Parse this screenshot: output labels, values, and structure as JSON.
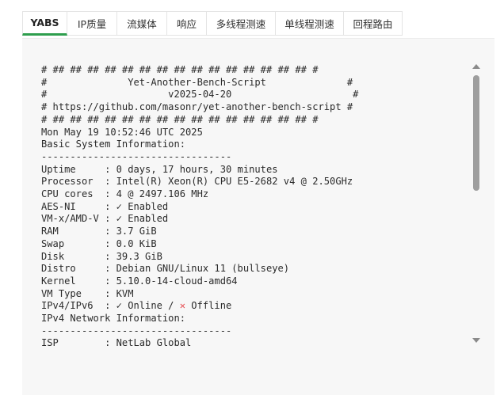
{
  "tabs": [
    {
      "label": "YABS",
      "active": true
    },
    {
      "label": "IP质量",
      "active": false
    },
    {
      "label": "流媒体",
      "active": false
    },
    {
      "label": "响应",
      "active": false
    },
    {
      "label": "多线程测速",
      "active": false
    },
    {
      "label": "单线程测速",
      "active": false
    },
    {
      "label": "回程路由",
      "active": false
    }
  ],
  "console": {
    "lines": {
      "l01": "# ## ## ## ## ## ## ## ## ## ## ## ## ## ## ## #",
      "l02": "#              Yet-Another-Bench-Script              #",
      "l03": "#                     v2025-04-20                     #",
      "l04": "# https://github.com/masonr/yet-another-bench-script #",
      "l05": "# ## ## ## ## ## ## ## ## ## ## ## ## ## ## ## #",
      "l06": "Mon May 19 10:52:46 UTC 2025",
      "l07": "Basic System Information:",
      "l08": "---------------------------------",
      "l09": "Uptime     : 0 days, 17 hours, 30 minutes",
      "l10": "Processor  : Intel(R) Xeon(R) CPU E5-2682 v4 @ 2.50GHz",
      "l11": "CPU cores  : 4 @ 2497.106 MHz",
      "l12": "AES-NI     : ✓ Enabled",
      "l13": "VM-x/AMD-V : ✓ Enabled",
      "l14": "RAM        : 3.7 GiB",
      "l15": "Swap       : 0.0 KiB",
      "l16": "Disk       : 39.3 GiB",
      "l17": "Distro     : Debian GNU/Linux 11 (bullseye)",
      "l18": "Kernel     : 5.10.0-14-cloud-amd64",
      "l19": "VM Type    : KVM",
      "l20a": "IPv4/IPv6  : ✓ Online / ",
      "l20x": "✕",
      "l20b": " Offline",
      "l21": "IPv4 Network Information:",
      "l22": "---------------------------------",
      "l23": "ISP        : NetLab Global"
    }
  },
  "colors": {
    "active_tab_underline": "#2e9e4d",
    "offline_mark": "#e5484d"
  }
}
